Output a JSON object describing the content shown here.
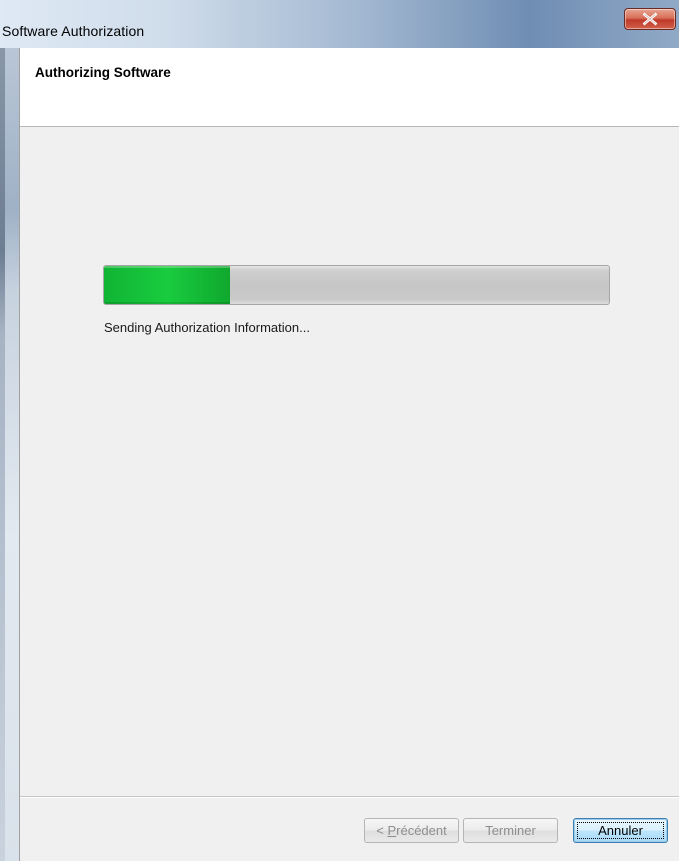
{
  "window": {
    "title": "Software Authorization"
  },
  "header": {
    "title": "Authorizing Software"
  },
  "progress": {
    "value": 0.25,
    "fill_color": "#19cc3e"
  },
  "status": {
    "text": "Sending Authorization Information..."
  },
  "buttons": {
    "previous_prefix": "< ",
    "previous_mnemonic": "P",
    "previous_rest": "récédent",
    "finish_label": "Terminer",
    "cancel_label": "Annuler"
  },
  "icons": {
    "close": "close-icon"
  }
}
